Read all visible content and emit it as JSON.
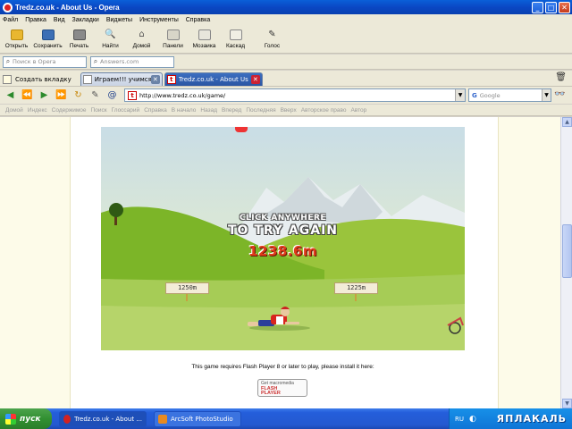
{
  "window": {
    "title": "Tredz.co.uk - About Us - Opera",
    "minimize": "_",
    "maximize": "□",
    "close": "✕"
  },
  "menu": [
    "Файл",
    "Правка",
    "Вид",
    "Закладки",
    "Виджеты",
    "Инструменты",
    "Справка"
  ],
  "toolbar": [
    {
      "label": "Открыть",
      "icon": "folder-icon",
      "color": "#e9b730"
    },
    {
      "label": "Сохранить",
      "icon": "save-icon",
      "color": "#3c6fb5"
    },
    {
      "label": "Печать",
      "icon": "print-icon",
      "color": "#6d6d6d"
    },
    {
      "label": "Найти",
      "icon": "find-icon",
      "color": "#6d6d6d"
    },
    {
      "label": "Домой",
      "icon": "home-icon",
      "color": "#6d6d6d"
    },
    {
      "label": "Панели",
      "icon": "panels-icon",
      "color": "#6d6d6d"
    },
    {
      "label": "Мозаика",
      "icon": "tile-icon",
      "color": "#6d6d6d"
    },
    {
      "label": "Каскад",
      "icon": "cascade-icon",
      "color": "#6d6d6d"
    },
    {
      "label": "Голос",
      "icon": "voice-icon",
      "color": "#333333"
    }
  ],
  "search": {
    "opera_placeholder": "Поиск в Opera",
    "answers_placeholder": "Answers.com"
  },
  "tabs": {
    "new_tab_label": "Создать вкладку",
    "items": [
      {
        "label": "Играем!!! учимся бить ...",
        "active": false
      },
      {
        "label": "Tredz.co.uk - About Us",
        "active": true
      }
    ]
  },
  "address": {
    "url": "http://www.tredz.co.uk/game/",
    "search_engine": "Google"
  },
  "navbar": [
    "Домой",
    "Индекс",
    "Содержимое",
    "Поиск",
    "Глоссарий",
    "Справка",
    "В начало",
    "Назад",
    "Вперед",
    "Последняя",
    "Вверх",
    "Авторское право",
    "Автор"
  ],
  "game": {
    "line1": "CLICK ANYWHERE",
    "line2": "TO TRY AGAIN",
    "distance": "1238.6m",
    "marker_left": "1250m",
    "marker_right": "1225m"
  },
  "page": {
    "flash_notice": "This game requires Flash Player 8 or later to play, please install it here:",
    "badge_line1": "Get macromedia",
    "badge_line2": "FLASH",
    "badge_line3": "PLAYER"
  },
  "taskbar": {
    "start": "пуск",
    "tasks": [
      {
        "label": "Tredz.co.uk - About ...",
        "pressed": true,
        "color": "#d22222"
      },
      {
        "label": "ArcSoft PhotoStudio",
        "pressed": false,
        "color": "#e88a20"
      }
    ],
    "lang": "RU",
    "watermark": "ЯПЛАКАЛЬ"
  }
}
